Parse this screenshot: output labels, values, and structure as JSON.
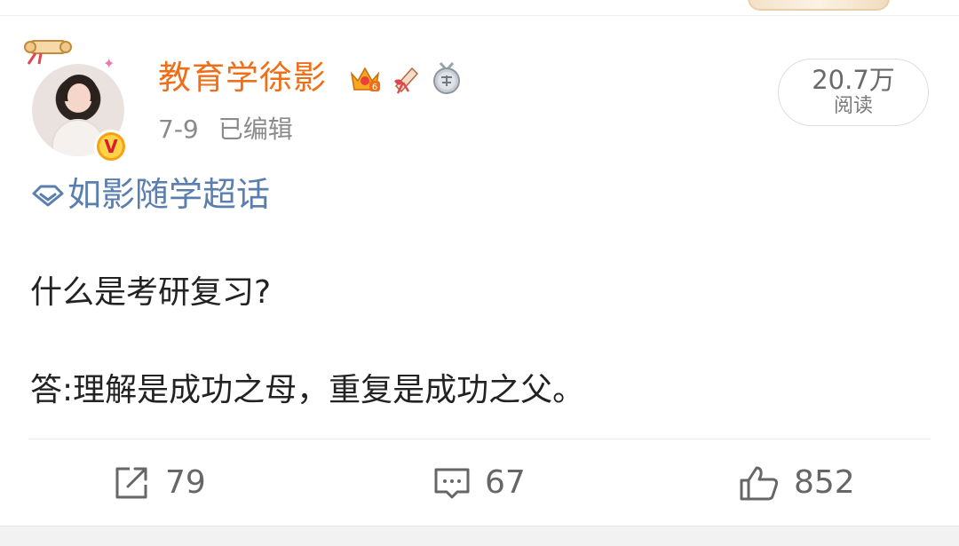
{
  "post": {
    "author": "教育学徐影",
    "date": "7-9",
    "edited": "已编辑",
    "reads": {
      "count": "20.7万",
      "label": "阅读"
    },
    "topic": "如影随学超话",
    "lines": [
      "什么是考研复习?",
      "答:理解是成功之母，重复是成功之父。"
    ],
    "badges": [
      "crown-level-badge",
      "trumpet-badge",
      "answer-medal-badge"
    ],
    "badge_level": "6",
    "verified_mark": "V"
  },
  "actions": {
    "repost": {
      "icon": "repost-icon",
      "count": "79"
    },
    "comment": {
      "icon": "comment-icon",
      "count": "67"
    },
    "like": {
      "icon": "thumbs-up-icon",
      "count": "852"
    }
  },
  "colors": {
    "username": "#f06e17",
    "topic": "#5a7fae",
    "text": "#222222",
    "meta": "#8a8a8a",
    "action": "#666666"
  }
}
